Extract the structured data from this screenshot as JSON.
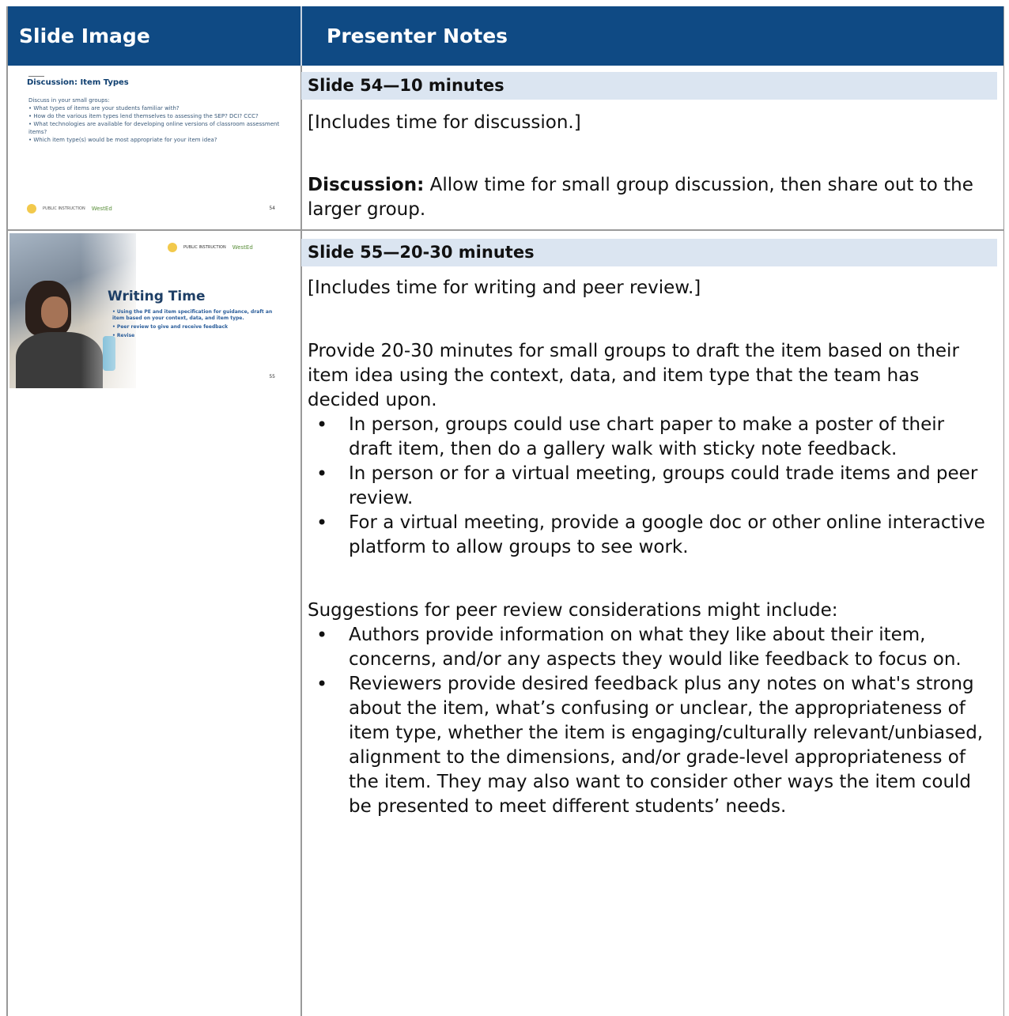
{
  "header": {
    "col_left": "Slide Image",
    "col_right": "Presenter Notes"
  },
  "rows": [
    {
      "title": "Slide 54—10 minutes",
      "thumbnail": {
        "title": "Discussion: Item Types",
        "intro": "Discuss in your small groups:",
        "bullets": [
          "• What types of items are your students familiar with?",
          "• How do the various item types lend themselves to assessing the SEP? DCI? CCC?",
          "• What technologies are available for developing online versions of classroom assessment items?",
          "• Which item type(s) would be most appropriate for your item idea?"
        ],
        "logo_osp": "PUBLIC INSTRUCTION",
        "logo_wested": "WestEd",
        "page": "54"
      },
      "notes": {
        "p1": "[Includes time for discussion.]",
        "p2_label": "Discussion:",
        "p2_text": " Allow time for small group discussion, then share out to the larger group."
      }
    },
    {
      "title": "Slide 55—20-30 minutes",
      "thumbnail": {
        "title": "Writing Time",
        "bullets": [
          "• Using the PE and item specification for guidance, draft an item based on your context, data, and item type.",
          "• Peer review to give and receive feedback",
          "• Revise"
        ],
        "logo_osp": "PUBLIC INSTRUCTION",
        "logo_wested": "WestEd",
        "page": "55"
      },
      "notes": {
        "p1": "[Includes time for writing and peer review.]",
        "p2": "Provide 20-30 minutes for small groups to draft the item based on their item idea using the context, data, and item type that the team has decided upon.",
        "list1": [
          "In person, groups could use chart paper to make a poster of their draft item, then do a gallery walk with sticky note feedback.",
          "In person or for a virtual meeting, groups could trade items and peer review.",
          "For a virtual meeting, provide a google doc or other online interactive platform to allow groups to see work."
        ],
        "p3": "Suggestions for peer review considerations might include:",
        "list2": [
          "Authors provide information on what they like about their item, concerns, and/or any aspects they would like feedback to focus on.",
          "Reviewers provide desired feedback plus any notes on what's strong about the item, what’s confusing or unclear, the appropriateness of item type, whether the item is engaging/culturally relevant/unbiased, alignment to the dimensions, and/or grade-level appropriateness of the item. They may also want to consider other ways the item could be presented to meet different students’ needs."
        ]
      }
    }
  ]
}
